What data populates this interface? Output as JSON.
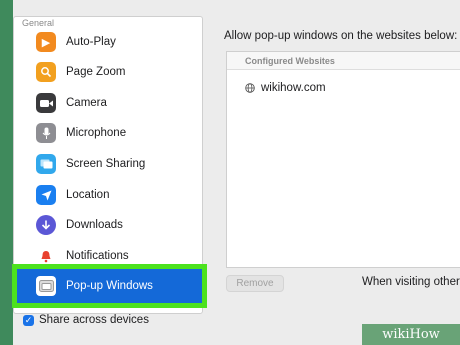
{
  "sidebar": {
    "section_label": "General",
    "items": [
      {
        "label": "Auto-Play",
        "icon": "auto-play-icon",
        "color": "#f28a1f"
      },
      {
        "label": "Page Zoom",
        "icon": "page-zoom-icon",
        "color": "#f2a01f"
      },
      {
        "label": "Camera",
        "icon": "camera-icon",
        "color": "#3a3a3c"
      },
      {
        "label": "Microphone",
        "icon": "microphone-icon",
        "color": "#8e8e93"
      },
      {
        "label": "Screen Sharing",
        "icon": "screen-sharing-icon",
        "color": "#31a8ec"
      },
      {
        "label": "Location",
        "icon": "location-icon",
        "color": "#1a7ff0"
      },
      {
        "label": "Downloads",
        "icon": "downloads-icon",
        "color": "#5b57d6"
      },
      {
        "label": "Notifications",
        "icon": "notifications-icon",
        "color": "#e8412f"
      },
      {
        "label": "Pop-up Windows",
        "icon": "pop-up-windows-icon",
        "color": "#ffffff",
        "selected": true
      }
    ]
  },
  "share": {
    "label": "Share across devices",
    "checked": true
  },
  "main": {
    "title": "Allow pop-up windows on the websites below:",
    "column_header": "Configured Websites",
    "sites": [
      "wikihow.com"
    ],
    "remove_label": "Remove",
    "visiting_label": "When visiting other"
  },
  "watermark": {
    "text": "wikiHow"
  },
  "colors": {
    "selection": "#1469d8",
    "highlight": "#4ce21e",
    "background": "#3f8a5c"
  }
}
